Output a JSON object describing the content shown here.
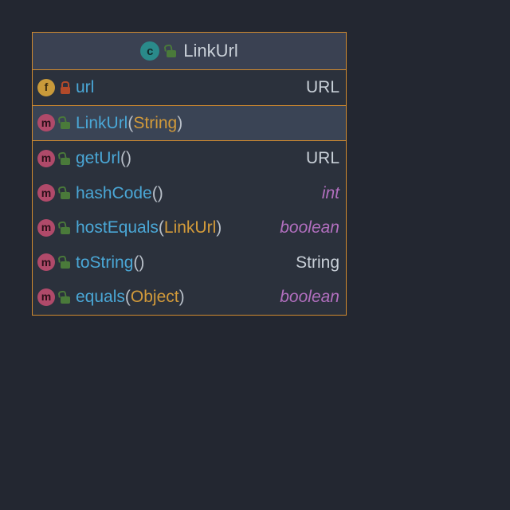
{
  "class": {
    "kind_icon": "c",
    "visibility": "public",
    "name": "LinkUrl"
  },
  "fields": [
    {
      "icon": "f",
      "visibility": "private",
      "name": "url",
      "type": "URL",
      "primitive": false
    }
  ],
  "constructors": [
    {
      "icon": "m",
      "visibility": "public",
      "name": "LinkUrl",
      "params": "String",
      "selected": true
    }
  ],
  "methods": [
    {
      "icon": "m",
      "visibility": "public",
      "name": "getUrl",
      "params": "",
      "return": "URL",
      "primitive": false
    },
    {
      "icon": "m",
      "visibility": "public",
      "name": "hashCode",
      "params": "",
      "return": "int",
      "primitive": true
    },
    {
      "icon": "m",
      "visibility": "public",
      "name": "hostEquals",
      "params": "LinkUrl",
      "return": "boolean",
      "primitive": true
    },
    {
      "icon": "m",
      "visibility": "public",
      "name": "toString",
      "params": "",
      "return": "String",
      "primitive": false
    },
    {
      "icon": "m",
      "visibility": "public",
      "name": "equals",
      "params": "Object",
      "return": "boolean",
      "primitive": true
    }
  ]
}
